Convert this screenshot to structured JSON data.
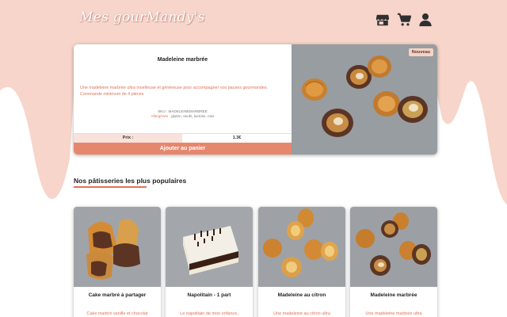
{
  "header": {
    "logo_text": "Mes gourMandy's",
    "icons": [
      "shop-icon",
      "cart-icon",
      "user-icon"
    ]
  },
  "featured": {
    "title": "Madeleine marbrée",
    "description": "Une madeleine marbrée ultra moelleuse et généreuse pour accompagner vos pauses gourmandes. Commande minimum de 4 pièces",
    "sku": "SKU : MADELEINEMARBREE",
    "allergens_label": "Allergènes :",
    "allergens": "gluten, oeufs, lactose, noix",
    "price_label": "Prix :",
    "price": "1.3€",
    "add_button": "Ajouter au panier",
    "badge": "Nouveau"
  },
  "popular": {
    "title": "Nos pâtisseries les plus populaires",
    "items": [
      {
        "title": "Cake marbré à partager",
        "desc": "Cake marbré vanille et chocolat"
      },
      {
        "title": "Napolitain - 1 part",
        "desc": "Le napolitain de mon enfance,"
      },
      {
        "title": "Madeleine au citron",
        "desc": "Une madeleine au citron ultra"
      },
      {
        "title": "Madeleine marbrée",
        "desc": "Une madeleine marbrée ultra"
      }
    ]
  },
  "colors": {
    "accent": "#e6876d",
    "text_accent": "#e0725a",
    "wave": "#f7d5cb",
    "photo_bg": "#9fa3a8"
  }
}
